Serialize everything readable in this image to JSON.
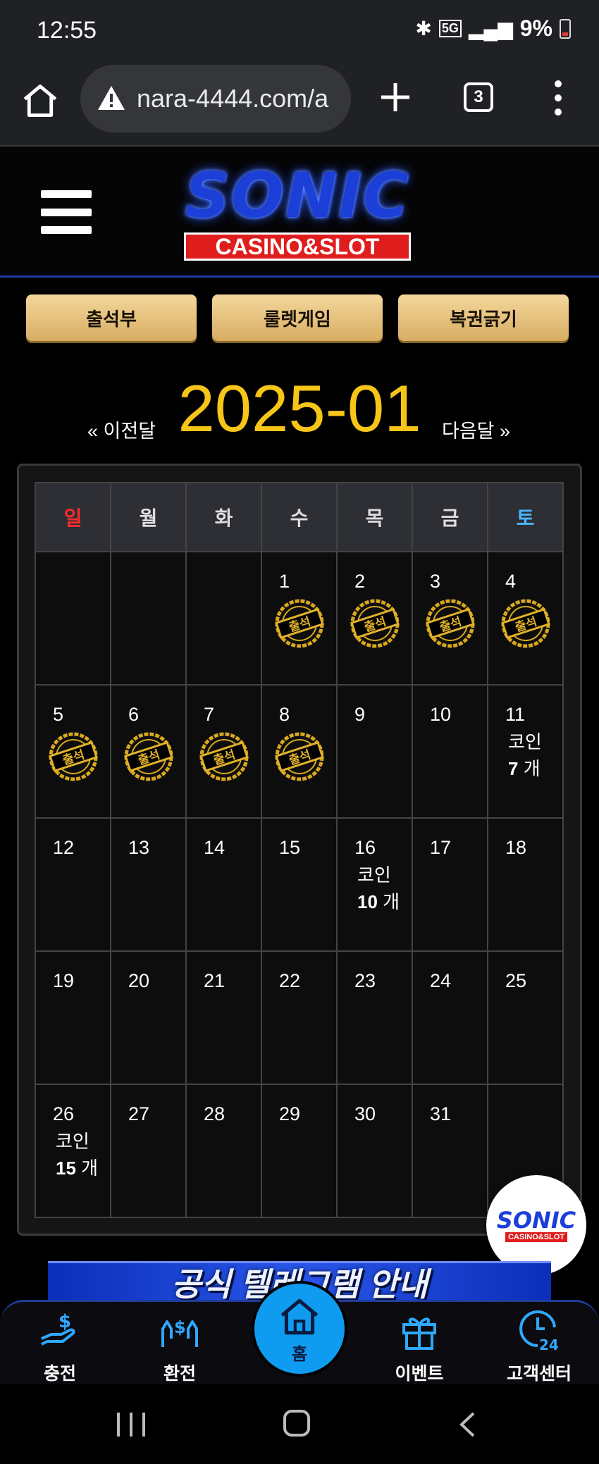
{
  "status_bar": {
    "time": "12:55",
    "battery": "9%",
    "network": "5G"
  },
  "browser": {
    "url": "nara-4444.com/a",
    "tab_count": "3"
  },
  "header": {
    "logo_main": "SONIC",
    "logo_sub": "CASINO&SLOT"
  },
  "actions": [
    {
      "label": "출석부"
    },
    {
      "label": "룰렛게임"
    },
    {
      "label": "복권긁기"
    }
  ],
  "calendar": {
    "prev_label": "« 이전달",
    "month": "2025-01",
    "next_label": "다음달 »",
    "weekdays": [
      "일",
      "월",
      "화",
      "수",
      "목",
      "금",
      "토"
    ],
    "stamp_text": "출석",
    "coin_label": "코인",
    "days": [
      {
        "day": "",
        "stamp": false
      },
      {
        "day": "",
        "stamp": false
      },
      {
        "day": "",
        "stamp": false
      },
      {
        "day": "1",
        "stamp": true
      },
      {
        "day": "2",
        "stamp": true
      },
      {
        "day": "3",
        "stamp": true
      },
      {
        "day": "4",
        "stamp": true
      },
      {
        "day": "5",
        "stamp": true
      },
      {
        "day": "6",
        "stamp": true
      },
      {
        "day": "7",
        "stamp": true
      },
      {
        "day": "8",
        "stamp": true
      },
      {
        "day": "9",
        "stamp": false
      },
      {
        "day": "10",
        "stamp": false
      },
      {
        "day": "11",
        "stamp": false,
        "coins": "7",
        "unit": "개"
      },
      {
        "day": "12",
        "stamp": false
      },
      {
        "day": "13",
        "stamp": false
      },
      {
        "day": "14",
        "stamp": false
      },
      {
        "day": "15",
        "stamp": false
      },
      {
        "day": "16",
        "stamp": false,
        "coins": "10",
        "unit": "개"
      },
      {
        "day": "17",
        "stamp": false
      },
      {
        "day": "18",
        "stamp": false
      },
      {
        "day": "19",
        "stamp": false
      },
      {
        "day": "20",
        "stamp": false
      },
      {
        "day": "21",
        "stamp": false
      },
      {
        "day": "22",
        "stamp": false
      },
      {
        "day": "23",
        "stamp": false
      },
      {
        "day": "24",
        "stamp": false
      },
      {
        "day": "25",
        "stamp": false
      },
      {
        "day": "26",
        "stamp": false,
        "coins": "15",
        "unit": "개"
      },
      {
        "day": "27",
        "stamp": false
      },
      {
        "day": "28",
        "stamp": false
      },
      {
        "day": "29",
        "stamp": false
      },
      {
        "day": "30",
        "stamp": false
      },
      {
        "day": "31",
        "stamp": false
      },
      {
        "day": "",
        "stamp": false
      }
    ]
  },
  "floating_logo": {
    "main": "SONIC",
    "sub": "CASINO&SLOT"
  },
  "banner": {
    "text": "공식 텔레그램 안내"
  },
  "bottom_nav": {
    "deposit": "충전",
    "withdraw": "환전",
    "home": "홈",
    "event": "이벤트",
    "support": "고객센터",
    "support_badge": "24"
  },
  "colors": {
    "accent_gold": "#f6c518",
    "button_gold": "#e3bd78",
    "brand_blue": "#1c3fd8",
    "home_blue": "#0f9cf0",
    "sunday_red": "#ff2b2b",
    "saturday_blue": "#48b8ff"
  }
}
